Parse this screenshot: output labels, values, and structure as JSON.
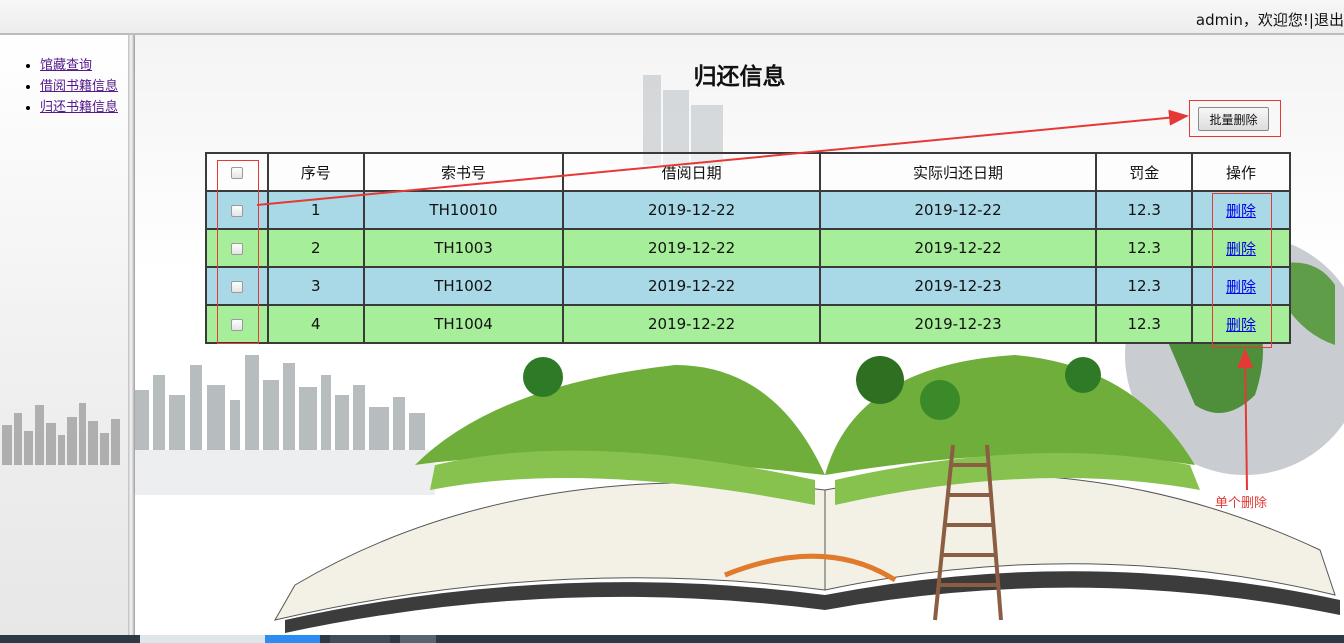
{
  "header": {
    "user": "admin",
    "welcome": "，欢迎您!",
    "separator": "|",
    "logout": "退出"
  },
  "sidebar": {
    "items": [
      {
        "label": "馆藏查询"
      },
      {
        "label": "借阅书籍信息"
      },
      {
        "label": "归还书籍信息"
      }
    ]
  },
  "main": {
    "title": "归还信息",
    "batch_delete_label": "批量删除",
    "table": {
      "headers": [
        "",
        "序号",
        "索书号",
        "借阅日期",
        "实际归还日期",
        "罚金",
        "操作"
      ],
      "rows": [
        {
          "no": "1",
          "call_number": "TH10010",
          "borrow_date": "2019-12-22",
          "return_date": "2019-12-22",
          "fine": "12.3",
          "action": "删除"
        },
        {
          "no": "2",
          "call_number": "TH1003",
          "borrow_date": "2019-12-22",
          "return_date": "2019-12-22",
          "fine": "12.3",
          "action": "删除"
        },
        {
          "no": "3",
          "call_number": "TH1002",
          "borrow_date": "2019-12-22",
          "return_date": "2019-12-23",
          "fine": "12.3",
          "action": "删除"
        },
        {
          "no": "4",
          "call_number": "TH1004",
          "borrow_date": "2019-12-22",
          "return_date": "2019-12-23",
          "fine": "12.3",
          "action": "删除"
        }
      ]
    }
  },
  "annotation": {
    "single_delete_label": "单个删除"
  },
  "colors": {
    "row_blue": "#a9d8e6",
    "row_green": "#a6ee99",
    "annotation_red": "#e53935",
    "link_blue": "#0000ee",
    "visited_purple": "#551a8b"
  }
}
